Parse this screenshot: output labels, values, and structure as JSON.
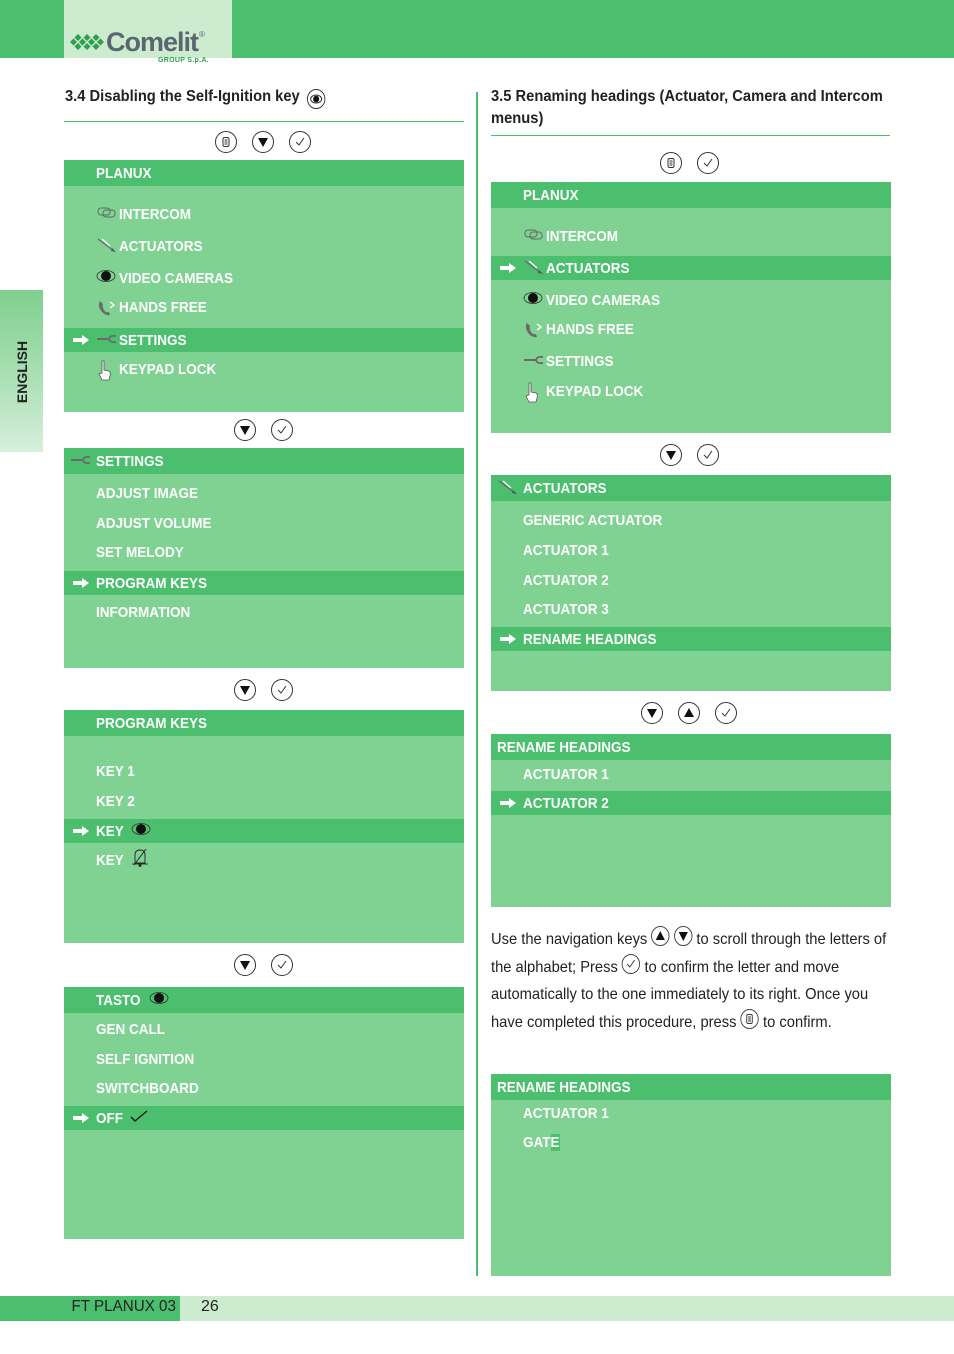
{
  "brand": {
    "name": "Comelit",
    "registered": "®",
    "group": "GROUP S.p.A."
  },
  "colors": {
    "primary_green": "#4cbf6f",
    "screen_green": "#80d292",
    "light_green": "#ccebcf",
    "text": "#222222"
  },
  "side_tab": {
    "label": "ENGLISH"
  },
  "section_left": {
    "title": "3.4 Disabling the Self-Ignition key",
    "title_icon": "camera-eye-icon",
    "steps": [
      {
        "keys": [
          "menu-key-icon",
          "down-key-icon",
          "confirm-key-icon"
        ],
        "screen": {
          "header": "PLANUX",
          "items": [
            {
              "label": "INTERCOM",
              "icon": "intercom-icon",
              "selected": false
            },
            {
              "label": "ACTUATORS",
              "icon": "actuator-icon",
              "selected": false
            },
            {
              "label": "VIDEO CAMERAS",
              "icon": "camera-eye-icon",
              "selected": false
            },
            {
              "label": "HANDS FREE",
              "icon": "handset-icon",
              "selected": false
            },
            {
              "label": "SETTINGS",
              "icon": "wrench-icon",
              "selected": true
            },
            {
              "label": "KEYPAD LOCK",
              "icon": "hand-pointer-icon",
              "selected": false
            }
          ]
        }
      },
      {
        "keys": [
          "down-key-icon",
          "confirm-key-icon"
        ],
        "screen": {
          "header": "SETTINGS",
          "header_icon": "wrench-icon",
          "items": [
            {
              "label": "ADJUST IMAGE",
              "selected": false
            },
            {
              "label": "ADJUST VOLUME",
              "selected": false
            },
            {
              "label": "SET MELODY",
              "selected": false
            },
            {
              "label": "PROGRAM KEYS",
              "selected": true
            },
            {
              "label": "INFORMATION",
              "selected": false
            }
          ]
        }
      },
      {
        "keys": [
          "down-key-icon",
          "confirm-key-icon"
        ],
        "screen": {
          "header": "PROGRAM KEYS",
          "items": [
            {
              "label": "KEY 1",
              "selected": false
            },
            {
              "label": "KEY 2",
              "selected": false
            },
            {
              "label": "KEY",
              "suffix_icon": "camera-eye-icon",
              "selected": true
            },
            {
              "label": "KEY",
              "suffix_icon": "bell-off-icon",
              "selected": false
            }
          ]
        }
      },
      {
        "keys": [
          "down-key-icon",
          "confirm-key-icon"
        ],
        "screen": {
          "header": "TASTO",
          "header_suffix_icon": "camera-eye-icon",
          "items": [
            {
              "label": "GEN CALL",
              "selected": false
            },
            {
              "label": "SELF IGNITION",
              "selected": false
            },
            {
              "label": "SWITCHBOARD",
              "selected": false
            },
            {
              "label": "OFF",
              "suffix_icon": "checkmark-icon",
              "selected": true
            }
          ]
        }
      }
    ]
  },
  "section_right": {
    "title_line1": "3.5 Renaming headings (Actuator, Camera and Intercom",
    "title_line2": "menus)",
    "steps": [
      {
        "keys": [
          "menu-key-icon",
          "confirm-key-icon"
        ],
        "screen": {
          "header": "PLANUX",
          "items": [
            {
              "label": "INTERCOM",
              "icon": "intercom-icon",
              "selected": false
            },
            {
              "label": "ACTUATORS",
              "icon": "actuator-icon",
              "selected": true
            },
            {
              "label": "VIDEO CAMERAS",
              "icon": "camera-eye-icon",
              "selected": false
            },
            {
              "label": "HANDS FREE",
              "icon": "handset-icon",
              "selected": false
            },
            {
              "label": "SETTINGS",
              "icon": "wrench-icon",
              "selected": false
            },
            {
              "label": "KEYPAD LOCK",
              "icon": "hand-pointer-icon",
              "selected": false
            }
          ]
        }
      },
      {
        "keys": [
          "down-key-icon",
          "confirm-key-icon"
        ],
        "screen": {
          "header": "ACTUATORS",
          "header_icon": "actuator-icon",
          "items": [
            {
              "label": "GENERIC ACTUATOR",
              "selected": false
            },
            {
              "label": "ACTUATOR 1",
              "selected": false
            },
            {
              "label": "ACTUATOR 2",
              "selected": false
            },
            {
              "label": "ACTUATOR 3",
              "selected": false
            },
            {
              "label": "RENAME HEADINGS",
              "selected": true
            }
          ]
        }
      },
      {
        "keys": [
          "down-key-icon",
          "up-key-icon",
          "confirm-key-icon"
        ],
        "screen": {
          "header": "RENAME HEADINGS",
          "items": [
            {
              "label": "ACTUATOR 1",
              "selected": false
            },
            {
              "label": "ACTUATOR 2",
              "selected": true
            }
          ]
        }
      }
    ],
    "instructions": {
      "part1": "Use the navigation keys",
      "part2": "to scroll through the letters of",
      "part3": "the alphabet; Press",
      "part4": "to confirm the letter and move",
      "part5": "automatically to the one immediately to its right. Once you",
      "part6": "have completed this procedure, press",
      "part7": "to confirm."
    },
    "final_screen": {
      "header": "RENAME HEADINGS",
      "items": [
        {
          "label": "ACTUATOR 1"
        },
        {
          "label_prefix": "GAT",
          "cursor_char": "E"
        }
      ]
    }
  },
  "footer": {
    "doc_code": "FT PLANUX 03",
    "page_number": "26"
  }
}
